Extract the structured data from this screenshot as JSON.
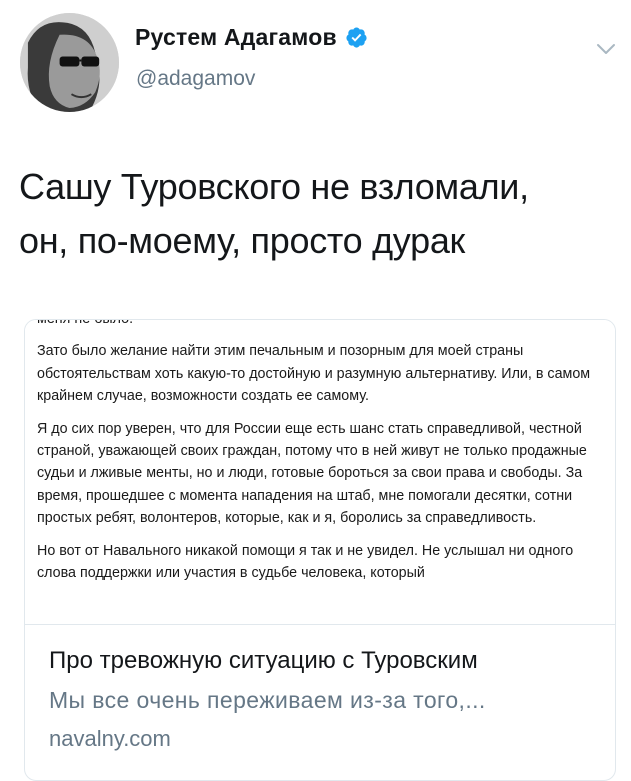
{
  "author": {
    "display_name": "Рустем Адагамов",
    "handle": "@adagamov",
    "verified": true,
    "verified_color": "#1da1f2"
  },
  "icons": {
    "verified": "verified-badge-icon",
    "menu": "chevron-down-icon"
  },
  "tweet": {
    "line1": "Сашу Туровского не взломали,",
    "line2": "он, по-моему, просто дурак"
  },
  "card": {
    "image_text": {
      "top_cut": "меня не было.",
      "p1": "Зато было желание найти этим печальным и позорным для моей страны обстоятельствам хоть какую-то достойную и разумную альтернативу. Или, в самом крайнем случае, возможности создать ее самому.",
      "p2": "Я до сих пор уверен, что для России еще есть шанс стать справедливой, честной страной, уважающей своих граждан, потому что в ней живут не только продажные судьи и лживые менты, но и люди, готовые бороться за свои права и свободы. За время, прошедшее с момента нападения на штаб, мне помогали десятки, сотни простых ребят, волонтеров, которые, как и я, боролись за справедливость.",
      "p3": "Но вот от Навального никакой помощи я так и не увидел. Не услышал ни одного слова поддержки или участия в судьбе человека, который"
    },
    "title": "Про тревожную ситуацию с Туровским",
    "description": "Мы все очень переживаем из-за того,...",
    "domain": "navalny.com"
  }
}
